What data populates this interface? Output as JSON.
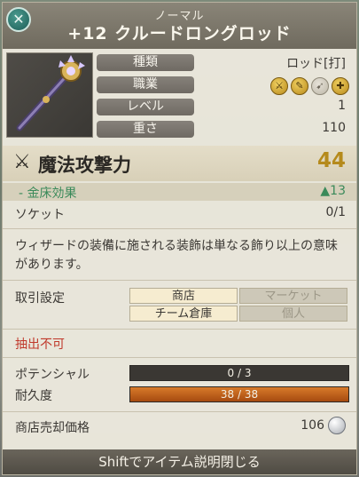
{
  "header": {
    "rarity": "ノーマル",
    "name": "+12 クルードロングロッド"
  },
  "item_image": {
    "icon": "rod-icon"
  },
  "stats": [
    {
      "label": "種類",
      "value": "ロッド[打]"
    },
    {
      "label": "職業",
      "value": ""
    },
    {
      "label": "レベル",
      "value": "1"
    },
    {
      "label": "重さ",
      "value": "110"
    }
  ],
  "jobs": [
    {
      "icon": "sword-job-icon",
      "active": true
    },
    {
      "icon": "staff-job-icon",
      "active": true
    },
    {
      "icon": "bow-job-icon",
      "active": false
    },
    {
      "icon": "cross-job-icon",
      "active": true
    }
  ],
  "attack": {
    "label": "魔法攻撃力",
    "value": "44",
    "color": "#b58a1c"
  },
  "gold_bed": {
    "label": "- 金床効果",
    "value": "▲13",
    "color": "#3a8a5a"
  },
  "socket": {
    "label": "ソケット",
    "value": "0/1"
  },
  "description": "ウィザードの装備に施される装飾は単なる飾り以上の意味があります。",
  "trade": {
    "label": "取引設定",
    "options": [
      {
        "label": "商店",
        "enabled": true
      },
      {
        "label": "マーケット",
        "enabled": false
      },
      {
        "label": "チーム倉庫",
        "enabled": true
      },
      {
        "label": "個人",
        "enabled": false
      }
    ]
  },
  "extract": {
    "label": "抽出不可",
    "color": "#c0392b"
  },
  "potential": {
    "label": "ポテンシャル",
    "current": 0,
    "max": 3,
    "text": "0 / 3"
  },
  "durability": {
    "label": "耐久度",
    "current": 38,
    "max": 38,
    "text": "38 / 38"
  },
  "sell": {
    "label": "商店売却価格",
    "value": "106"
  },
  "footer": {
    "hint": "Shiftでアイテム説明閉じる"
  }
}
